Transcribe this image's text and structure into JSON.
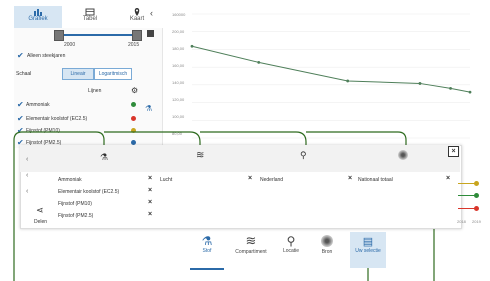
{
  "tabs": [
    {
      "label": "Grafiek",
      "icon": "bar-chart-icon",
      "active": true
    },
    {
      "label": "Tabel",
      "icon": "table-icon",
      "active": false
    },
    {
      "label": "Kaart",
      "icon": "map-pin-icon",
      "active": false
    }
  ],
  "slider": {
    "start": "2000",
    "end": "2015"
  },
  "only_measured": "Alleen steekjaren",
  "scale": {
    "label": "Schaal",
    "linear": "Lineair",
    "log": "Logaritmisch"
  },
  "lines_label": "Lijnen",
  "series": [
    {
      "name": "Ammoniak",
      "color": "#2e8b3a"
    },
    {
      "name": "Elementair koolstof (EC2.5)",
      "color": "#d9362b"
    },
    {
      "name": "Fijnstof (PM10)",
      "color": "#c8a51e"
    },
    {
      "name": "Fijnstof (PM2.5)",
      "color": "#2b6aa8"
    }
  ],
  "chart": {
    "yticks": [
      "160000",
      "200,00",
      "180,00",
      "160,00",
      "140,00",
      "120,00",
      "100,00",
      "80,00"
    ],
    "points": [
      {
        "x": 0.0,
        "y": 0.74
      },
      {
        "x": 0.24,
        "y": 0.61
      },
      {
        "x": 0.56,
        "y": 0.46
      },
      {
        "x": 0.82,
        "y": 0.44
      },
      {
        "x": 0.93,
        "y": 0.4
      },
      {
        "x": 1.0,
        "y": 0.37
      }
    ],
    "color": "#4f7f5a"
  },
  "overlay": {
    "rows": [
      [
        "Ammoniak",
        "Lucht",
        "Nederland",
        "Nationaal totaal"
      ],
      [
        "Elementair koolstof (EC2.5)",
        "",
        "",
        ""
      ],
      [
        "Fijnstof (PM10)",
        "",
        "",
        ""
      ],
      [
        "Fijnstof (PM2.5)",
        "",
        "",
        ""
      ]
    ],
    "share": "Delen",
    "close": "×"
  },
  "bottom": [
    {
      "label": "Stof",
      "icon": "flask-icon"
    },
    {
      "label": "Compartiment",
      "icon": "waves-icon"
    },
    {
      "label": "Locatie",
      "icon": "location-pin-icon"
    },
    {
      "label": "Bron",
      "icon": "target-icon"
    },
    {
      "label": "Uw selectie",
      "icon": "clipboard-icon"
    }
  ],
  "right_axis": [
    "2018",
    "2019"
  ]
}
